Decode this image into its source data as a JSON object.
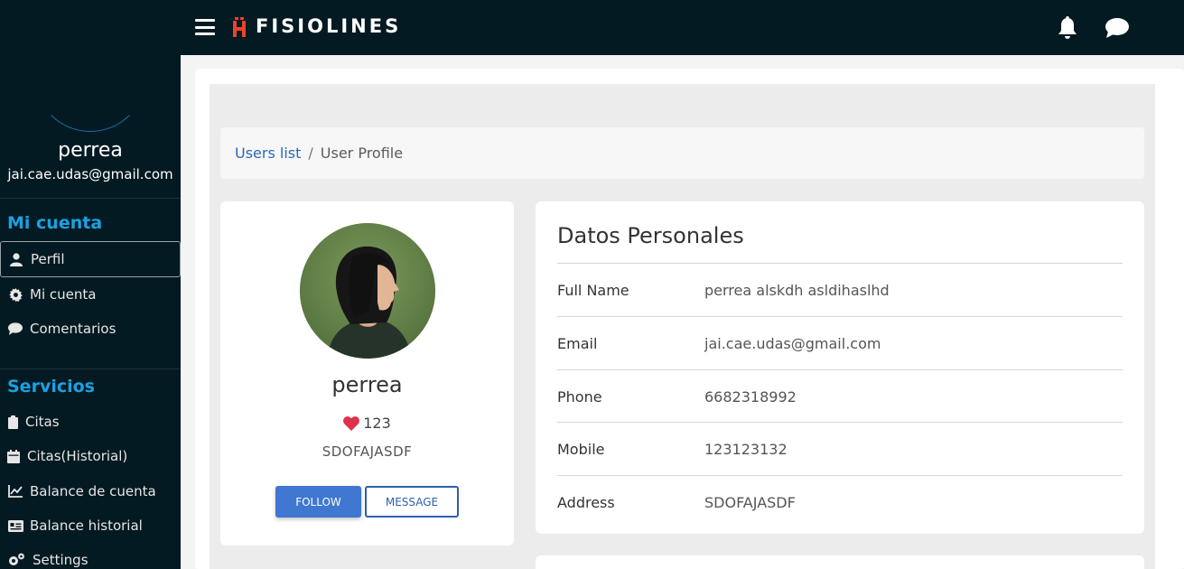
{
  "user": {
    "name": "perrea",
    "email": "jai.cae.udas@gmail.com"
  },
  "sidebar": {
    "section_account": "Mi cuenta",
    "account_items": [
      {
        "label": "Perfil",
        "icon": "user-icon"
      },
      {
        "label": "Mi cuenta",
        "icon": "gear-icon"
      },
      {
        "label": "Comentarios",
        "icon": "comment-icon"
      }
    ],
    "section_services": "Servicios",
    "service_items": [
      {
        "label": "Citas",
        "icon": "clipboard-icon"
      },
      {
        "label": "Citas(Historial)",
        "icon": "calendar-icon"
      },
      {
        "label": "Balance de cuenta",
        "icon": "chart-line-icon"
      },
      {
        "label": "Balance historial",
        "icon": "id-card-icon"
      },
      {
        "label": "Settings",
        "icon": "gears-icon"
      }
    ]
  },
  "topbar": {
    "brand": "FISIOLINES",
    "icons": [
      "menu-icon",
      "bell-icon",
      "chat-icon"
    ]
  },
  "breadcrumb": {
    "link": "Users list",
    "separator": "/",
    "current": "User Profile"
  },
  "profile": {
    "name": "perrea",
    "likes": "123",
    "tag": "SDOFAJASDF",
    "follow_label": "FOLLOW",
    "message_label": "MESSAGE"
  },
  "personal": {
    "title": "Datos Personales",
    "rows": [
      {
        "label": "Full Name",
        "value": "perrea alskdh asldihaslhd"
      },
      {
        "label": "Email",
        "value": "jai.cae.udas@gmail.com"
      },
      {
        "label": "Phone",
        "value": "6682318992"
      },
      {
        "label": "Mobile",
        "value": "123123132"
      },
      {
        "label": "Address",
        "value": "SDOFAJASDF"
      }
    ]
  },
  "colors": {
    "sidebar_bg": "#041a22",
    "accent": "#1aa1e2",
    "primary_button": "#3f77d1",
    "heart": "#e0314b",
    "logo": "#e8452c"
  }
}
